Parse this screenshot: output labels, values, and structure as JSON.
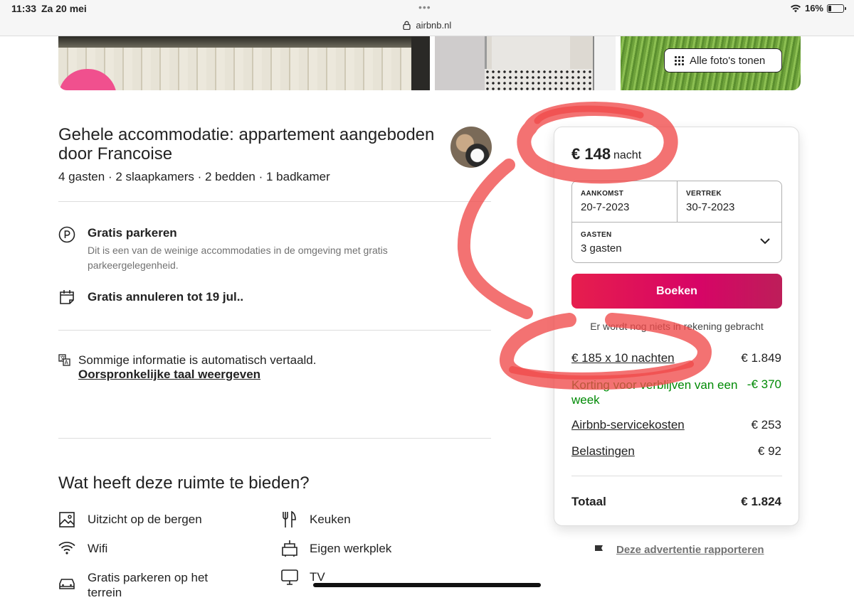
{
  "status_bar": {
    "time": "11:33",
    "date": "Za 20 mei",
    "battery": "16%",
    "url": "airbnb.nl"
  },
  "photos": {
    "all_photos_label": "Alle foto's tonen"
  },
  "listing": {
    "title": "Gehele accommodatie: appartement aangeboden door Francoise",
    "meta": "4 gasten · 2 slaapkamers · 2 bedden · 1 badkamer",
    "features": [
      {
        "title": "Gratis parkeren",
        "subtitle": "Dit is een van de weinige accommodaties in de omgeving met gratis parkeergelegenheid."
      },
      {
        "title": "Gratis annuleren tot 19 jul..",
        "subtitle": ""
      }
    ],
    "translation": {
      "notice": "Sommige informatie is automatisch vertaald.",
      "link": "Oorspronkelijke taal weergeven"
    },
    "amenities_title": "Wat heeft deze ruimte te bieden?",
    "amenities": [
      {
        "label": "Uitzicht op de bergen",
        "icon": "mountain-view-icon"
      },
      {
        "label": "Keuken",
        "icon": "kitchen-icon"
      },
      {
        "label": "Wifi",
        "icon": "wifi-icon"
      },
      {
        "label": "Eigen werkplek",
        "icon": "workspace-icon"
      },
      {
        "label": "Gratis parkeren op het terrein",
        "icon": "car-icon"
      },
      {
        "label": "TV",
        "icon": "tv-icon"
      }
    ]
  },
  "booking": {
    "price": "€ 148",
    "per": "nacht",
    "checkin_label": "AANKOMST",
    "checkin": "20-7-2023",
    "checkout_label": "VERTREK",
    "checkout": "30-7-2023",
    "guests_label": "GASTEN",
    "guests": "3 gasten",
    "book_button": "Boeken",
    "no_charge": "Er wordt nog niets in rekening gebracht",
    "lines": [
      {
        "label": "€ 185 x 10 nachten",
        "value": "€ 1.849"
      },
      {
        "label": "Korting voor verblijven van een week",
        "value": "-€ 370"
      },
      {
        "label": "Airbnb-servicekosten",
        "value": "€ 253"
      },
      {
        "label": "Belastingen",
        "value": "€ 92"
      }
    ],
    "total_label": "Totaal",
    "total": "€ 1.824",
    "report": "Deze advertentie rapporteren"
  },
  "colors": {
    "brand": "#e61e4d",
    "discount": "#008a05",
    "annotation": "#f04a4a"
  }
}
